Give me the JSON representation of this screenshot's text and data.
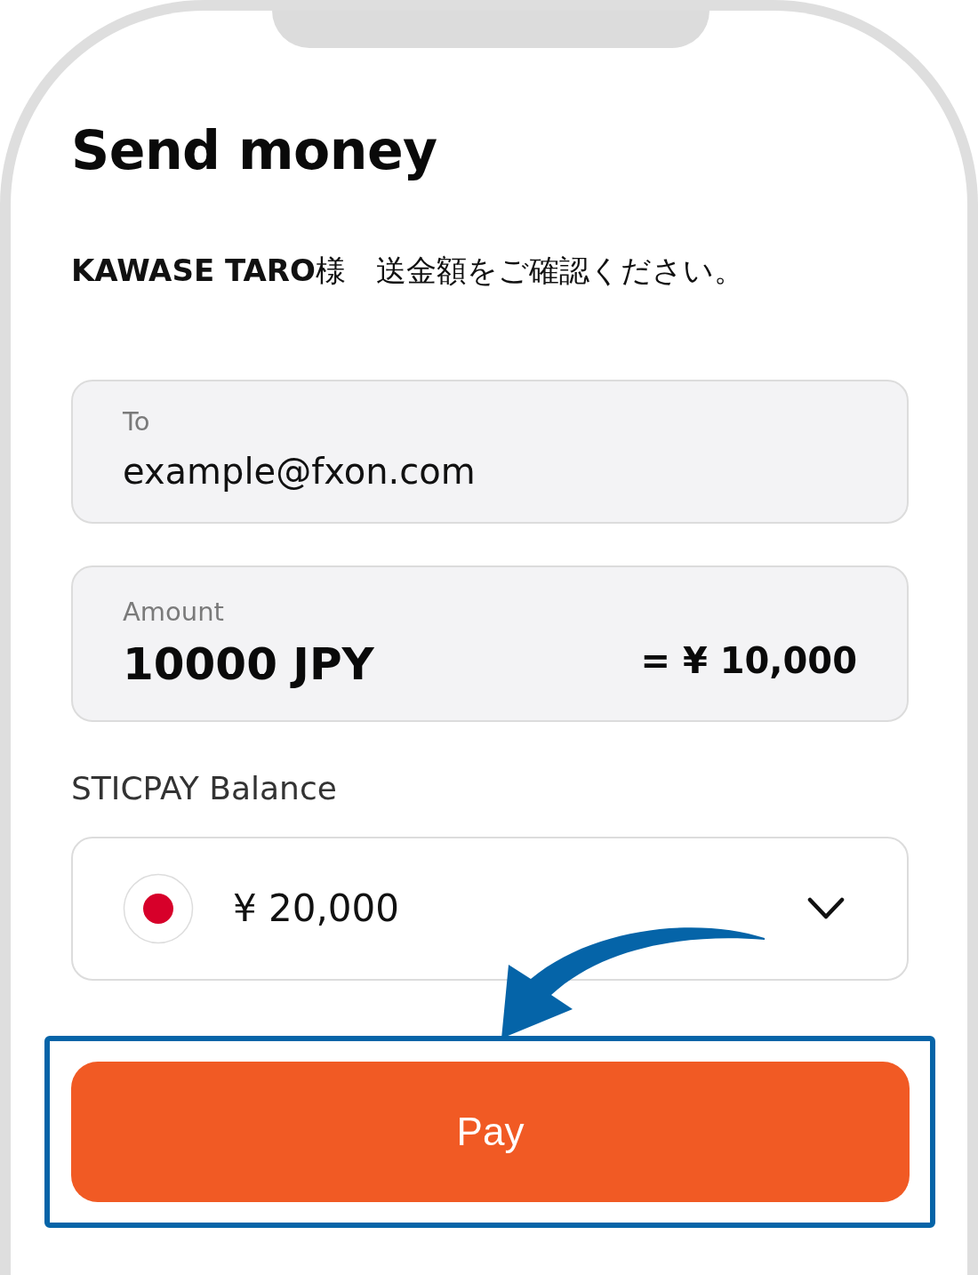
{
  "title": "Send money",
  "greeting": "**KAWASE TARO**様　送金額をご確認ください。",
  "to_field": {
    "label": "To",
    "value": "example@fxon.com"
  },
  "amount_field": {
    "label": "Amount",
    "value": "10000 JPY",
    "conversion": "= ¥ 10,000"
  },
  "balance": {
    "label": "STICPAY Balance",
    "amount": "¥ 20,000"
  },
  "pay_button": {
    "label": "Pay",
    "highlighted": true
  }
}
